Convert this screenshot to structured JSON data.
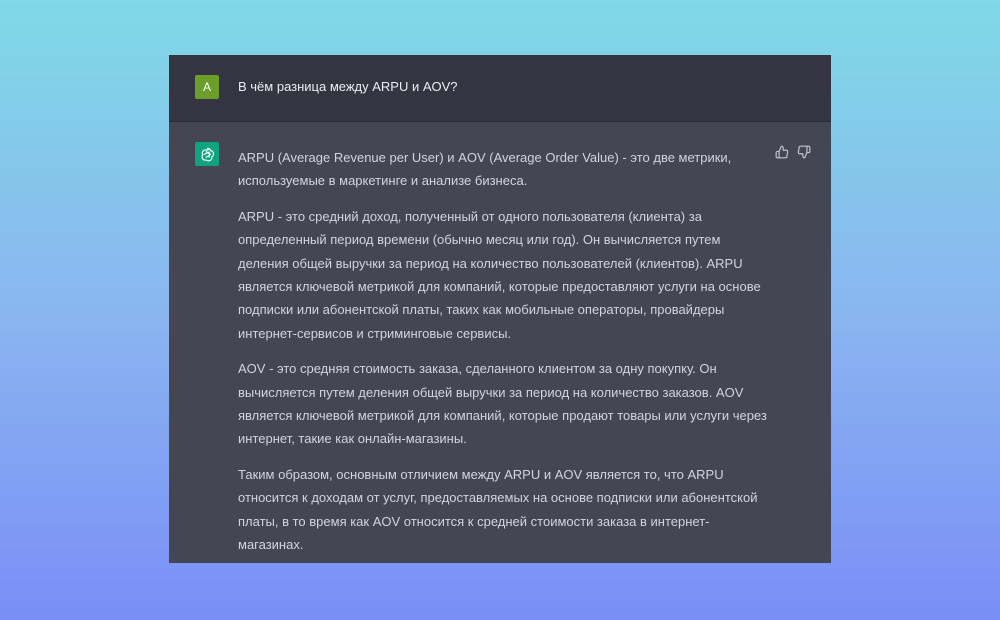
{
  "conversation": {
    "user": {
      "avatar_letter": "A",
      "avatar_color": "#6b9e2a",
      "message": "В чём разница между ARPU и AOV?"
    },
    "assistant": {
      "avatar_icon": "openai-logo-icon",
      "avatar_color": "#10a37f",
      "feedback": {
        "like_icon": "thumbs-up-icon",
        "dislike_icon": "thumbs-down-icon"
      },
      "paragraphs": [
        "ARPU (Average Revenue per User) и AOV (Average Order Value) - это две метрики, используемые в маркетинге и анализе бизнеса.",
        "ARPU - это средний доход, полученный от одного пользователя (клиента) за определенный период времени (обычно месяц или год). Он вычисляется путем деления общей выручки за период на количество пользователей (клиентов). ARPU является ключевой метрикой для компаний, которые предоставляют услуги на основе подписки или абонентской платы, таких как мобильные операторы, провайдеры интернет-сервисов и стриминговые сервисы.",
        "AOV - это средняя стоимость заказа, сделанного клиентом за одну покупку. Он вычисляется путем деления общей выручки за период на количество заказов. AOV является ключевой метрикой для компаний, которые продают товары или услуги через интернет, такие как онлайн-магазины.",
        "Таким образом, основным отличием между ARPU и AOV является то, что ARPU относится к доходам от услуг, предоставляемых на основе подписки или абонентской платы, в то время как AOV относится к средней стоимости заказа в интернет-магазинах."
      ]
    }
  }
}
